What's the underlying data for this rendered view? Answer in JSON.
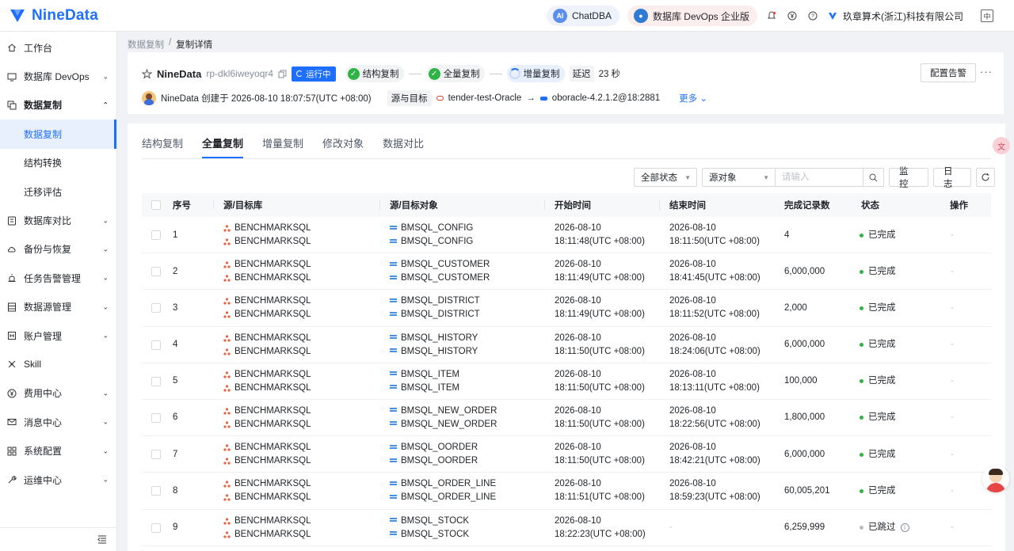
{
  "brand": {
    "logo_text": "NineData",
    "accent": "#1f6fff"
  },
  "topbar": {
    "chatdba": "ChatDBA",
    "devops_edition": "数据库 DevOps 企业版",
    "company": "玖章算术(浙江)科技有限公司",
    "icons": [
      "bell-icon",
      "yen-icon",
      "help-icon",
      "company-icon",
      "language-icon"
    ]
  },
  "sidebar": {
    "items": [
      {
        "label": "工作台",
        "icon": "home-icon",
        "expandable": false
      },
      {
        "label": "数据库 DevOps",
        "icon": "monitor-icon",
        "expandable": true
      },
      {
        "label": "数据复制",
        "icon": "copy-icon",
        "expandable": true,
        "open": true
      },
      {
        "label": "数据库对比",
        "icon": "compare-icon",
        "expandable": true
      },
      {
        "label": "备份与恢复",
        "icon": "cloud-icon",
        "expandable": true
      },
      {
        "label": "任务告警管理",
        "icon": "alarm-icon",
        "expandable": true
      },
      {
        "label": "数据源管理",
        "icon": "datasource-icon",
        "expandable": true
      },
      {
        "label": "账户管理",
        "icon": "account-icon",
        "expandable": true
      },
      {
        "label": "Skill",
        "icon": "skill-icon",
        "expandable": false
      },
      {
        "label": "费用中心",
        "icon": "yen-icon",
        "expandable": true
      },
      {
        "label": "消息中心",
        "icon": "mail-icon",
        "expandable": true
      },
      {
        "label": "系统配置",
        "icon": "grid-icon",
        "expandable": true
      },
      {
        "label": "运维中心",
        "icon": "wrench-icon",
        "expandable": true
      }
    ],
    "sub_items": [
      "数据复制",
      "结构转换",
      "迁移评估"
    ]
  },
  "breadcrumb": {
    "parent": "数据复制",
    "sep": "/",
    "current": "复制详情"
  },
  "task": {
    "name": "NineData",
    "id": "rp-dkl6iweyoqr4",
    "status": "运行中",
    "stages": [
      "结构复制",
      "全量复制",
      "增量复制"
    ],
    "delay_label": "延迟",
    "delay_value": "23 秒",
    "creator_line": "NineData 创建于 2026-08-10 18:07:57(UTC +08:00)",
    "src_target_label": "源与目标",
    "source": "tender-test-Oracle",
    "target": "oboracle-4.2.1.2@18:2881",
    "more": "更多",
    "alarm_button": "配置告警"
  },
  "tabs": [
    "结构复制",
    "全量复制",
    "增量复制",
    "修改对象",
    "数据对比"
  ],
  "active_tab": 1,
  "toolbar": {
    "status_filter": "全部状态",
    "object_filter": "源对象",
    "search_placeholder": "请输入",
    "monitor": "监 控",
    "log": "日 志"
  },
  "table": {
    "columns": [
      "序号",
      "源/目标库",
      "源/目标对象",
      "开始时间",
      "结束时间",
      "完成记录数",
      "状态",
      "操作"
    ],
    "rows": [
      {
        "no": "1",
        "src_db": "BENCHMARKSQL",
        "dst_db": "BENCHMARKSQL",
        "src_obj": "BMSQL_CONFIG",
        "dst_obj": "BMSQL_CONFIG",
        "start_date": "2026-08-10",
        "start_time": "18:11:48(UTC +08:00)",
        "end_date": "2026-08-10",
        "end_time": "18:11:50(UTC +08:00)",
        "records": "4",
        "status": "已完成",
        "action": "-"
      },
      {
        "no": "2",
        "src_db": "BENCHMARKSQL",
        "dst_db": "BENCHMARKSQL",
        "src_obj": "BMSQL_CUSTOMER",
        "dst_obj": "BMSQL_CUSTOMER",
        "start_date": "2026-08-10",
        "start_time": "18:11:49(UTC +08:00)",
        "end_date": "2026-08-10",
        "end_time": "18:41:45(UTC +08:00)",
        "records": "6,000,000",
        "status": "已完成",
        "action": "-"
      },
      {
        "no": "3",
        "src_db": "BENCHMARKSQL",
        "dst_db": "BENCHMARKSQL",
        "src_obj": "BMSQL_DISTRICT",
        "dst_obj": "BMSQL_DISTRICT",
        "start_date": "2026-08-10",
        "start_time": "18:11:49(UTC +08:00)",
        "end_date": "2026-08-10",
        "end_time": "18:11:52(UTC +08:00)",
        "records": "2,000",
        "status": "已完成",
        "action": "-"
      },
      {
        "no": "4",
        "src_db": "BENCHMARKSQL",
        "dst_db": "BENCHMARKSQL",
        "src_obj": "BMSQL_HISTORY",
        "dst_obj": "BMSQL_HISTORY",
        "start_date": "2026-08-10",
        "start_time": "18:11:50(UTC +08:00)",
        "end_date": "2026-08-10",
        "end_time": "18:24:06(UTC +08:00)",
        "records": "6,000,000",
        "status": "已完成",
        "action": "-"
      },
      {
        "no": "5",
        "src_db": "BENCHMARKSQL",
        "dst_db": "BENCHMARKSQL",
        "src_obj": "BMSQL_ITEM",
        "dst_obj": "BMSQL_ITEM",
        "start_date": "2026-08-10",
        "start_time": "18:11:50(UTC +08:00)",
        "end_date": "2026-08-10",
        "end_time": "18:13:11(UTC +08:00)",
        "records": "100,000",
        "status": "已完成",
        "action": "-"
      },
      {
        "no": "6",
        "src_db": "BENCHMARKSQL",
        "dst_db": "BENCHMARKSQL",
        "src_obj": "BMSQL_NEW_ORDER",
        "dst_obj": "BMSQL_NEW_ORDER",
        "start_date": "2026-08-10",
        "start_time": "18:11:50(UTC +08:00)",
        "end_date": "2026-08-10",
        "end_time": "18:22:56(UTC +08:00)",
        "records": "1,800,000",
        "status": "已完成",
        "action": "-"
      },
      {
        "no": "7",
        "src_db": "BENCHMARKSQL",
        "dst_db": "BENCHMARKSQL",
        "src_obj": "BMSQL_OORDER",
        "dst_obj": "BMSQL_OORDER",
        "start_date": "2026-08-10",
        "start_time": "18:11:50(UTC +08:00)",
        "end_date": "2026-08-10",
        "end_time": "18:42:21(UTC +08:00)",
        "records": "6,000,000",
        "status": "已完成",
        "action": "-"
      },
      {
        "no": "8",
        "src_db": "BENCHMARKSQL",
        "dst_db": "BENCHMARKSQL",
        "src_obj": "BMSQL_ORDER_LINE",
        "dst_obj": "BMSQL_ORDER_LINE",
        "start_date": "2026-08-10",
        "start_time": "18:11:51(UTC +08:00)",
        "end_date": "2026-08-10",
        "end_time": "18:59:23(UTC +08:00)",
        "records": "60,005,201",
        "status": "已完成",
        "action": "-"
      },
      {
        "no": "9",
        "src_db": "BENCHMARKSQL",
        "dst_db": "BENCHMARKSQL",
        "src_obj": "BMSQL_STOCK",
        "dst_obj": "BMSQL_STOCK",
        "start_date": "2026-08-10",
        "start_time": "18:22:23(UTC +08:00)",
        "end_date": "",
        "end_time": "-",
        "records": "6,259,999",
        "status": "已跳过",
        "skipped": true,
        "action": "-"
      }
    ]
  },
  "colors": {
    "success": "#2fb344",
    "running_badge": "#1f6fff",
    "skipped": "#b8bcc2"
  }
}
